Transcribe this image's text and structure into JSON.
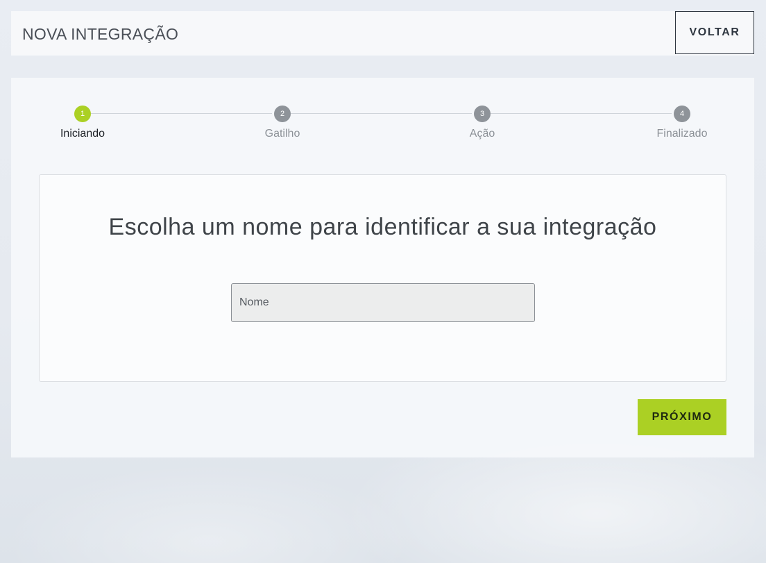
{
  "header": {
    "title": "NOVA INTEGRAÇÃO",
    "back_label": "VOLTAR"
  },
  "stepper": {
    "steps": [
      {
        "number": "1",
        "label": "Iniciando",
        "active": true
      },
      {
        "number": "2",
        "label": "Gatilho",
        "active": false
      },
      {
        "number": "3",
        "label": "Ação",
        "active": false
      },
      {
        "number": "4",
        "label": "Finalizado",
        "active": false
      }
    ]
  },
  "form": {
    "heading": "Escolha um nome para identificar a sua integração",
    "name_placeholder": "Nome",
    "name_value": ""
  },
  "actions": {
    "next_label": "PRÓXIMO"
  },
  "colors": {
    "accent": "#abd024",
    "inactive_step": "#8e9399"
  }
}
